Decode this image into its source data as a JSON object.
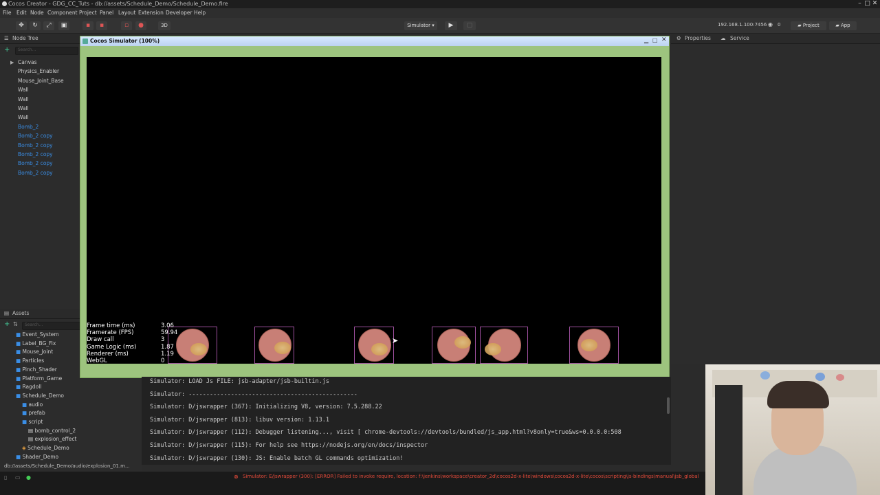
{
  "window": {
    "title": "Cocos Creator - GDG_CC_Tuts - db://assets/Schedule_Demo/Schedule_Demo.fire"
  },
  "menu": [
    "File",
    "Edit",
    "Node",
    "Component",
    "Project",
    "Panel",
    "Layout",
    "Extension",
    "Developer",
    "Help"
  ],
  "toolbar": {
    "mode_3d": "3D",
    "simulator_label": "Simulator ▾",
    "ip": "192.168.1.100:7456",
    "wifi_count": "0",
    "project_button": "Project",
    "app_button": "App"
  },
  "node_tree": {
    "title": "Node Tree",
    "search_placeholder": "Search...",
    "items": [
      {
        "label": "Canvas",
        "color": "#cccccc"
      },
      {
        "label": "Physics_Enabler",
        "color": "#cccccc"
      },
      {
        "label": "Mouse_Joint_Base",
        "color": "#cccccc"
      },
      {
        "label": "Wall",
        "color": "#cccccc"
      },
      {
        "label": "Wall",
        "color": "#cccccc"
      },
      {
        "label": "Wall",
        "color": "#cccccc"
      },
      {
        "label": "Wall",
        "color": "#cccccc"
      },
      {
        "label": "Bomb_2",
        "color": "#3a8ee6"
      },
      {
        "label": "Bomb_2 copy",
        "color": "#3a8ee6"
      },
      {
        "label": "Bomb_2 copy",
        "color": "#3a8ee6"
      },
      {
        "label": "Bomb_2 copy",
        "color": "#3a8ee6"
      },
      {
        "label": "Bomb_2 copy",
        "color": "#3a8ee6"
      },
      {
        "label": "Bomb_2 copy",
        "color": "#3a8ee6"
      }
    ]
  },
  "properties": {
    "tab1": "Properties",
    "tab2": "Service"
  },
  "assets": {
    "title": "Assets",
    "search_placeholder": "Search...",
    "items": [
      {
        "label": "Event_System",
        "indent": 1
      },
      {
        "label": "Label_BG_Fix",
        "indent": 1
      },
      {
        "label": "Mouse_Joint",
        "indent": 1
      },
      {
        "label": "Particles",
        "indent": 1
      },
      {
        "label": "Pinch_Shader",
        "indent": 1
      },
      {
        "label": "Platform_Game",
        "indent": 1
      },
      {
        "label": "Ragdoll",
        "indent": 1
      },
      {
        "label": "Schedule_Demo",
        "indent": 1
      },
      {
        "label": "audio",
        "indent": 2
      },
      {
        "label": "prefab",
        "indent": 2
      },
      {
        "label": "script",
        "indent": 2
      },
      {
        "label": "bomb_control_2",
        "indent": 3
      },
      {
        "label": "explosion_effect",
        "indent": 3
      },
      {
        "label": "Schedule_Demo",
        "indent": 2
      },
      {
        "label": "Shader_Demo",
        "indent": 1
      }
    ],
    "footer_path": "db://assets/Schedule_Demo/audio/explosion_01.m..."
  },
  "simulator": {
    "title": "Cocos Simulator (100%)",
    "stats": [
      {
        "label": "Frame time (ms)",
        "value": "3.06"
      },
      {
        "label": "Framerate (FPS)",
        "value": "59.94"
      },
      {
        "label": "Draw call",
        "value": "3"
      },
      {
        "label": "Game Logic (ms)",
        "value": "1.87"
      },
      {
        "label": "Renderer (ms)",
        "value": "1.19"
      },
      {
        "label": "WebGL",
        "value": "0"
      }
    ]
  },
  "console": {
    "lines": [
      "Simulator: LOAD Js FILE: jsb-adapter/jsb-builtin.js",
      "Simulator: ------------------------------------------------",
      "Simulator: D/jswrapper (367): Initializing V8, version: 7.5.288.22",
      "Simulator: D/jswrapper (813): libuv version: 1.13.1",
      "Simulator: D/jswrapper (112): Debugger listening..., visit [ chrome-devtools://devtools/bundled/js_app.html?v8only=true&ws=0.0.0.0:508",
      "Simulator: D/jswrapper (115): For help see https://nodejs.org/en/docs/inspector",
      "Simulator: D/jswrapper (130): JS: Enable batch GL commands optimization!"
    ]
  },
  "statusbar": {
    "error": "Simulator: E/jswrapper (300): [ERROR] Failed to invoke require, location: f:\\jenkins\\workspace\\creator_2d\\cocos2d-x-lite\\windows\\cocos2d-x-lite\\cocos\\scripting\\js-bindings\\manual\\jsb_global"
  },
  "colors": {
    "accent": "#3a8ee6",
    "sim_bg": "#9dc47e",
    "error": "#e24a3a"
  }
}
